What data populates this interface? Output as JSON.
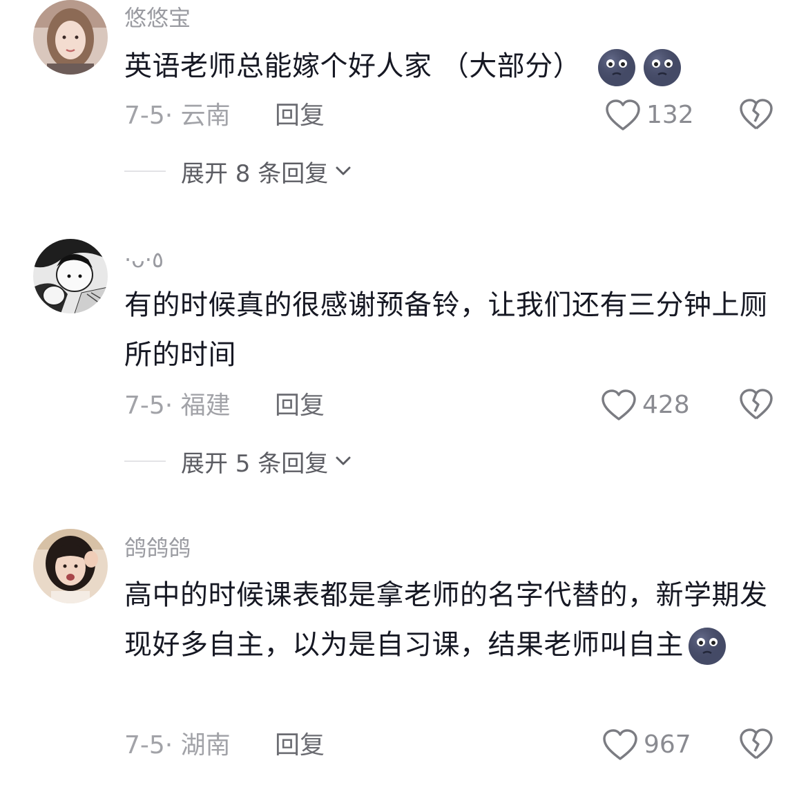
{
  "comments": [
    {
      "author": "悠悠宝",
      "text": "英语老师总能嫁个好人家 （大部分）",
      "emojis": [
        "nervous-moon-face-emoji",
        "nervous-moon-face-emoji"
      ],
      "date_location": "7-5· 云南",
      "reply_label": "回复",
      "likes": "132",
      "expand_label": "展开 8 条回复"
    },
    {
      "author": "·ᴗ·٥",
      "text": "有的时候真的很感谢预备铃，让我们还有三分钟上厕所的时间",
      "date_location": "7-5· 福建",
      "reply_label": "回复",
      "likes": "428",
      "expand_label": "展开 5 条回复"
    },
    {
      "author": "鸽鸽鸽",
      "text": "高中的时候课表都是拿老师的名字代替的，新学期发现好多自主，以为是自习课，结果老师叫自主",
      "emojis": [
        "nervous-moon-face-emoji"
      ],
      "date_location": "7-5· 湖南",
      "reply_label": "回复",
      "likes": "967"
    }
  ],
  "colors": {
    "text": "#161823",
    "muted": "#9a9ba1",
    "reply": "#6b6c72",
    "divider": "#e3e3e6"
  }
}
